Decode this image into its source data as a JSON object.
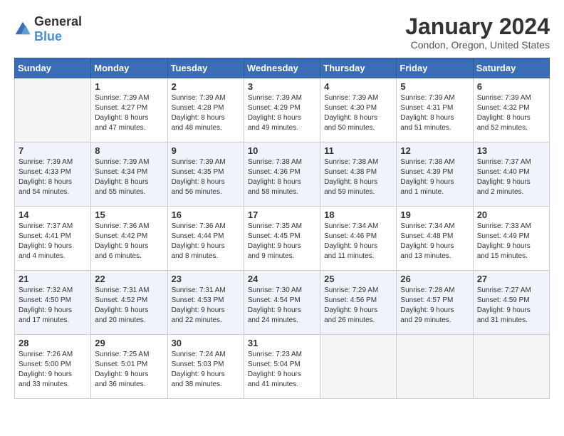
{
  "header": {
    "logo_general": "General",
    "logo_blue": "Blue",
    "month": "January 2024",
    "location": "Condon, Oregon, United States"
  },
  "weekdays": [
    "Sunday",
    "Monday",
    "Tuesday",
    "Wednesday",
    "Thursday",
    "Friday",
    "Saturday"
  ],
  "weeks": [
    [
      {
        "day": "",
        "info": ""
      },
      {
        "day": "1",
        "info": "Sunrise: 7:39 AM\nSunset: 4:27 PM\nDaylight: 8 hours\nand 47 minutes."
      },
      {
        "day": "2",
        "info": "Sunrise: 7:39 AM\nSunset: 4:28 PM\nDaylight: 8 hours\nand 48 minutes."
      },
      {
        "day": "3",
        "info": "Sunrise: 7:39 AM\nSunset: 4:29 PM\nDaylight: 8 hours\nand 49 minutes."
      },
      {
        "day": "4",
        "info": "Sunrise: 7:39 AM\nSunset: 4:30 PM\nDaylight: 8 hours\nand 50 minutes."
      },
      {
        "day": "5",
        "info": "Sunrise: 7:39 AM\nSunset: 4:31 PM\nDaylight: 8 hours\nand 51 minutes."
      },
      {
        "day": "6",
        "info": "Sunrise: 7:39 AM\nSunset: 4:32 PM\nDaylight: 8 hours\nand 52 minutes."
      }
    ],
    [
      {
        "day": "7",
        "info": "Sunrise: 7:39 AM\nSunset: 4:33 PM\nDaylight: 8 hours\nand 54 minutes."
      },
      {
        "day": "8",
        "info": "Sunrise: 7:39 AM\nSunset: 4:34 PM\nDaylight: 8 hours\nand 55 minutes."
      },
      {
        "day": "9",
        "info": "Sunrise: 7:39 AM\nSunset: 4:35 PM\nDaylight: 8 hours\nand 56 minutes."
      },
      {
        "day": "10",
        "info": "Sunrise: 7:38 AM\nSunset: 4:36 PM\nDaylight: 8 hours\nand 58 minutes."
      },
      {
        "day": "11",
        "info": "Sunrise: 7:38 AM\nSunset: 4:38 PM\nDaylight: 8 hours\nand 59 minutes."
      },
      {
        "day": "12",
        "info": "Sunrise: 7:38 AM\nSunset: 4:39 PM\nDaylight: 9 hours\nand 1 minute."
      },
      {
        "day": "13",
        "info": "Sunrise: 7:37 AM\nSunset: 4:40 PM\nDaylight: 9 hours\nand 2 minutes."
      }
    ],
    [
      {
        "day": "14",
        "info": "Sunrise: 7:37 AM\nSunset: 4:41 PM\nDaylight: 9 hours\nand 4 minutes."
      },
      {
        "day": "15",
        "info": "Sunrise: 7:36 AM\nSunset: 4:42 PM\nDaylight: 9 hours\nand 6 minutes."
      },
      {
        "day": "16",
        "info": "Sunrise: 7:36 AM\nSunset: 4:44 PM\nDaylight: 9 hours\nand 8 minutes."
      },
      {
        "day": "17",
        "info": "Sunrise: 7:35 AM\nSunset: 4:45 PM\nDaylight: 9 hours\nand 9 minutes."
      },
      {
        "day": "18",
        "info": "Sunrise: 7:34 AM\nSunset: 4:46 PM\nDaylight: 9 hours\nand 11 minutes."
      },
      {
        "day": "19",
        "info": "Sunrise: 7:34 AM\nSunset: 4:48 PM\nDaylight: 9 hours\nand 13 minutes."
      },
      {
        "day": "20",
        "info": "Sunrise: 7:33 AM\nSunset: 4:49 PM\nDaylight: 9 hours\nand 15 minutes."
      }
    ],
    [
      {
        "day": "21",
        "info": "Sunrise: 7:32 AM\nSunset: 4:50 PM\nDaylight: 9 hours\nand 17 minutes."
      },
      {
        "day": "22",
        "info": "Sunrise: 7:31 AM\nSunset: 4:52 PM\nDaylight: 9 hours\nand 20 minutes."
      },
      {
        "day": "23",
        "info": "Sunrise: 7:31 AM\nSunset: 4:53 PM\nDaylight: 9 hours\nand 22 minutes."
      },
      {
        "day": "24",
        "info": "Sunrise: 7:30 AM\nSunset: 4:54 PM\nDaylight: 9 hours\nand 24 minutes."
      },
      {
        "day": "25",
        "info": "Sunrise: 7:29 AM\nSunset: 4:56 PM\nDaylight: 9 hours\nand 26 minutes."
      },
      {
        "day": "26",
        "info": "Sunrise: 7:28 AM\nSunset: 4:57 PM\nDaylight: 9 hours\nand 29 minutes."
      },
      {
        "day": "27",
        "info": "Sunrise: 7:27 AM\nSunset: 4:59 PM\nDaylight: 9 hours\nand 31 minutes."
      }
    ],
    [
      {
        "day": "28",
        "info": "Sunrise: 7:26 AM\nSunset: 5:00 PM\nDaylight: 9 hours\nand 33 minutes."
      },
      {
        "day": "29",
        "info": "Sunrise: 7:25 AM\nSunset: 5:01 PM\nDaylight: 9 hours\nand 36 minutes."
      },
      {
        "day": "30",
        "info": "Sunrise: 7:24 AM\nSunset: 5:03 PM\nDaylight: 9 hours\nand 38 minutes."
      },
      {
        "day": "31",
        "info": "Sunrise: 7:23 AM\nSunset: 5:04 PM\nDaylight: 9 hours\nand 41 minutes."
      },
      {
        "day": "",
        "info": ""
      },
      {
        "day": "",
        "info": ""
      },
      {
        "day": "",
        "info": ""
      }
    ]
  ]
}
